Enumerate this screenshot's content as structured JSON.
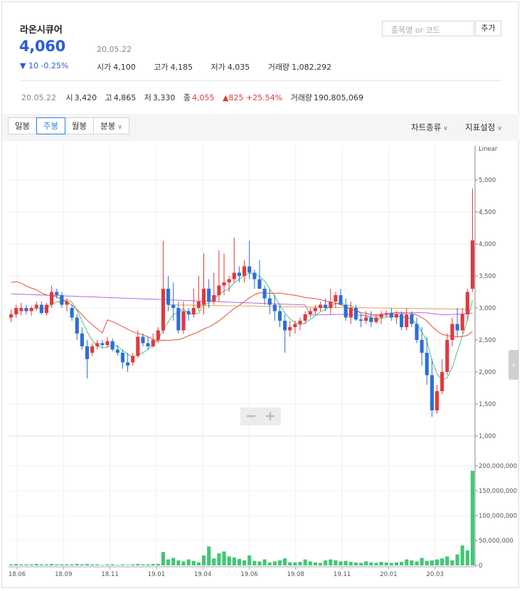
{
  "stock": {
    "name": "라온시큐어",
    "price": "4,060",
    "change": "▼ 10 -0.25%",
    "date": "20.05.22",
    "open_label": "시가",
    "open": "4,100",
    "high_label": "고가",
    "high": "4,185",
    "low_label": "저가",
    "low": "4,035",
    "volume_label": "거래량",
    "volume": "1,082,292"
  },
  "search": {
    "placeholder": "종목명 or 코드",
    "add_label": "추가"
  },
  "period_summary": {
    "date": "20.05.22",
    "open_label": "시",
    "open": "3,420",
    "high_label": "고",
    "high": "4,865",
    "low_label": "저",
    "low": "3,330",
    "close_label": "종",
    "close": "4,055",
    "change": "▲825 +25.54%",
    "volume_label": "거래량",
    "volume": "190,805,069"
  },
  "toolbar": {
    "tabs": [
      "일봉",
      "주봉",
      "월봉",
      "분봉"
    ],
    "active_tab": "주봉",
    "chart_type_label": "차트종류",
    "indicator_label": "지표설정"
  },
  "zoom": {
    "minus": "−",
    "plus": "+"
  },
  "colors": {
    "up": "#e0393e",
    "down": "#2b6fd6",
    "volume": "#41c774",
    "ma5": "#4ec37a",
    "ma20": "#e0533f",
    "ma60": "#b06ce0",
    "ma120": "#e5a35a"
  },
  "chart_data": {
    "type": "candlestick",
    "scale_label": "Linear",
    "price_axis": {
      "ticks": [
        "5,000",
        "4,500",
        "4,000",
        "3,500",
        "3,000",
        "2,500",
        "2,000",
        "1,500",
        "1,000"
      ],
      "ylim": [
        1000,
        5400
      ]
    },
    "volume_axis": {
      "ticks": [
        "200,000,000",
        "150,000,000",
        "100,000,000",
        "50,000,000",
        "0"
      ],
      "ylim": [
        0,
        220000000
      ]
    },
    "x_labels": [
      "18.06",
      "18.09",
      "18.11",
      "19.01",
      "19.04",
      "19.06",
      "19.08",
      "19.11",
      "20.01",
      "20.03"
    ],
    "candles": [
      {
        "o": 2850,
        "h": 2980,
        "l": 2780,
        "c": 2900
      },
      {
        "o": 2900,
        "h": 3050,
        "l": 2850,
        "c": 3000
      },
      {
        "o": 2950,
        "h": 3080,
        "l": 2880,
        "c": 3000
      },
      {
        "o": 3000,
        "h": 3050,
        "l": 2900,
        "c": 2950
      },
      {
        "o": 2950,
        "h": 3030,
        "l": 2880,
        "c": 3000
      },
      {
        "o": 3000,
        "h": 3100,
        "l": 2950,
        "c": 3050
      },
      {
        "o": 3050,
        "h": 3100,
        "l": 2900,
        "c": 2920
      },
      {
        "o": 2920,
        "h": 3080,
        "l": 2880,
        "c": 3050
      },
      {
        "o": 3050,
        "h": 3350,
        "l": 3000,
        "c": 3250
      },
      {
        "o": 3250,
        "h": 3300,
        "l": 3150,
        "c": 3200
      },
      {
        "o": 3200,
        "h": 3250,
        "l": 3000,
        "c": 3050
      },
      {
        "o": 3050,
        "h": 3150,
        "l": 2950,
        "c": 3100
      },
      {
        "o": 3000,
        "h": 3050,
        "l": 2800,
        "c": 2850
      },
      {
        "o": 2850,
        "h": 2900,
        "l": 2500,
        "c": 2600
      },
      {
        "o": 2600,
        "h": 2700,
        "l": 2350,
        "c": 2400
      },
      {
        "o": 2400,
        "h": 2500,
        "l": 1900,
        "c": 2200
      },
      {
        "o": 2300,
        "h": 2450,
        "l": 2250,
        "c": 2400
      },
      {
        "o": 2400,
        "h": 2500,
        "l": 2350,
        "c": 2450
      },
      {
        "o": 2450,
        "h": 2500,
        "l": 2380,
        "c": 2420
      },
      {
        "o": 2420,
        "h": 2550,
        "l": 2380,
        "c": 2480
      },
      {
        "o": 2480,
        "h": 2520,
        "l": 2320,
        "c": 2350
      },
      {
        "o": 2350,
        "h": 2420,
        "l": 2250,
        "c": 2300
      },
      {
        "o": 2300,
        "h": 2350,
        "l": 2050,
        "c": 2150
      },
      {
        "o": 2150,
        "h": 2300,
        "l": 2000,
        "c": 2100
      },
      {
        "o": 2150,
        "h": 2300,
        "l": 2100,
        "c": 2250
      },
      {
        "o": 2250,
        "h": 2650,
        "l": 2220,
        "c": 2550
      },
      {
        "o": 2550,
        "h": 2600,
        "l": 2400,
        "c": 2450
      },
      {
        "o": 2450,
        "h": 2550,
        "l": 2350,
        "c": 2400
      },
      {
        "o": 2400,
        "h": 2600,
        "l": 2380,
        "c": 2500
      },
      {
        "o": 2500,
        "h": 2700,
        "l": 2450,
        "c": 2650
      },
      {
        "o": 2650,
        "h": 4050,
        "l": 2600,
        "c": 3300
      },
      {
        "o": 3300,
        "h": 3500,
        "l": 2950,
        "c": 3050
      },
      {
        "o": 3050,
        "h": 3400,
        "l": 2800,
        "c": 3000
      },
      {
        "o": 3000,
        "h": 3100,
        "l": 2600,
        "c": 2650
      },
      {
        "o": 2650,
        "h": 3100,
        "l": 2600,
        "c": 2950
      },
      {
        "o": 2950,
        "h": 3000,
        "l": 2800,
        "c": 2900
      },
      {
        "o": 2900,
        "h": 3300,
        "l": 2850,
        "c": 3000
      },
      {
        "o": 3000,
        "h": 3500,
        "l": 2950,
        "c": 3100
      },
      {
        "o": 3050,
        "h": 3850,
        "l": 2900,
        "c": 3300
      },
      {
        "o": 3300,
        "h": 3450,
        "l": 3000,
        "c": 3100
      },
      {
        "o": 3100,
        "h": 3550,
        "l": 3050,
        "c": 3200
      },
      {
        "o": 3200,
        "h": 3900,
        "l": 3100,
        "c": 3350
      },
      {
        "o": 3350,
        "h": 3850,
        "l": 3200,
        "c": 3400
      },
      {
        "o": 3400,
        "h": 3500,
        "l": 3250,
        "c": 3450
      },
      {
        "o": 3450,
        "h": 4100,
        "l": 3400,
        "c": 3550
      },
      {
        "o": 3550,
        "h": 3650,
        "l": 3400,
        "c": 3500
      },
      {
        "o": 3500,
        "h": 3750,
        "l": 3400,
        "c": 3650
      },
      {
        "o": 3650,
        "h": 4050,
        "l": 3450,
        "c": 3550
      },
      {
        "o": 3550,
        "h": 3600,
        "l": 3300,
        "c": 3450
      },
      {
        "o": 3450,
        "h": 3750,
        "l": 3300,
        "c": 3300
      },
      {
        "o": 3300,
        "h": 3350,
        "l": 3050,
        "c": 3150
      },
      {
        "o": 3150,
        "h": 3300,
        "l": 2900,
        "c": 3050
      },
      {
        "o": 3050,
        "h": 3200,
        "l": 2800,
        "c": 2950
      },
      {
        "o": 2950,
        "h": 3050,
        "l": 2700,
        "c": 2800
      },
      {
        "o": 2800,
        "h": 2900,
        "l": 2300,
        "c": 2650
      },
      {
        "o": 2650,
        "h": 2800,
        "l": 2550,
        "c": 2700
      },
      {
        "o": 2700,
        "h": 2800,
        "l": 2600,
        "c": 2750
      },
      {
        "o": 2750,
        "h": 2850,
        "l": 2650,
        "c": 2800
      },
      {
        "o": 2800,
        "h": 2950,
        "l": 2750,
        "c": 2900
      },
      {
        "o": 2900,
        "h": 3000,
        "l": 2850,
        "c": 2950
      },
      {
        "o": 2950,
        "h": 3050,
        "l": 2900,
        "c": 3000
      },
      {
        "o": 3000,
        "h": 3100,
        "l": 2950,
        "c": 3050
      },
      {
        "o": 3050,
        "h": 3150,
        "l": 2950,
        "c": 3000
      },
      {
        "o": 3000,
        "h": 3300,
        "l": 2900,
        "c": 3100
      },
      {
        "o": 3100,
        "h": 3250,
        "l": 3000,
        "c": 3200
      },
      {
        "o": 3200,
        "h": 3300,
        "l": 3050,
        "c": 3050
      },
      {
        "o": 3050,
        "h": 3150,
        "l": 2800,
        "c": 2850
      },
      {
        "o": 2850,
        "h": 3100,
        "l": 2750,
        "c": 3000
      },
      {
        "o": 3000,
        "h": 3050,
        "l": 2800,
        "c": 2820
      },
      {
        "o": 2820,
        "h": 2900,
        "l": 2700,
        "c": 2800
      },
      {
        "o": 2800,
        "h": 2950,
        "l": 2750,
        "c": 2850
      },
      {
        "o": 2850,
        "h": 2950,
        "l": 2700,
        "c": 2780
      },
      {
        "o": 2780,
        "h": 2900,
        "l": 2750,
        "c": 2850
      },
      {
        "o": 2850,
        "h": 2950,
        "l": 2750,
        "c": 2900
      },
      {
        "o": 2900,
        "h": 2960,
        "l": 2850,
        "c": 2920
      },
      {
        "o": 2920,
        "h": 3000,
        "l": 2800,
        "c": 2850
      },
      {
        "o": 2850,
        "h": 2950,
        "l": 2750,
        "c": 2900
      },
      {
        "o": 2900,
        "h": 2950,
        "l": 2650,
        "c": 2700
      },
      {
        "o": 2700,
        "h": 3000,
        "l": 2650,
        "c": 2900
      },
      {
        "o": 2900,
        "h": 2950,
        "l": 2700,
        "c": 2750
      },
      {
        "o": 2750,
        "h": 2850,
        "l": 2450,
        "c": 2500
      },
      {
        "o": 2500,
        "h": 2700,
        "l": 2100,
        "c": 2300
      },
      {
        "o": 2300,
        "h": 2550,
        "l": 1800,
        "c": 1950
      },
      {
        "o": 1950,
        "h": 2200,
        "l": 1300,
        "c": 1400
      },
      {
        "o": 1400,
        "h": 1800,
        "l": 1350,
        "c": 1700
      },
      {
        "o": 1700,
        "h": 2200,
        "l": 1650,
        "c": 2000
      },
      {
        "o": 2000,
        "h": 2600,
        "l": 1950,
        "c": 2500
      },
      {
        "o": 2500,
        "h": 2850,
        "l": 2400,
        "c": 2750
      },
      {
        "o": 2750,
        "h": 3000,
        "l": 2550,
        "c": 2650
      },
      {
        "o": 2650,
        "h": 3000,
        "l": 2600,
        "c": 2900
      },
      {
        "o": 2900,
        "h": 3300,
        "l": 2800,
        "c": 3250
      },
      {
        "o": 3300,
        "h": 4865,
        "l": 3250,
        "c": 4055
      }
    ],
    "volumes": [
      2,
      3,
      2,
      2,
      2,
      3,
      2,
      2,
      3,
      2,
      2,
      2,
      2,
      3,
      2,
      3,
      2,
      2,
      1,
      2,
      2,
      1,
      2,
      1,
      2,
      3,
      2,
      2,
      3,
      3,
      27,
      12,
      15,
      10,
      8,
      12,
      9,
      6,
      20,
      38,
      14,
      24,
      28,
      18,
      16,
      13,
      10,
      20,
      9,
      8,
      12,
      6,
      8,
      10,
      14,
      6,
      6,
      7,
      12,
      8,
      6,
      5,
      10,
      12,
      10,
      8,
      9,
      7,
      6,
      5,
      8,
      6,
      5,
      7,
      6,
      5,
      6,
      7,
      12,
      10,
      8,
      15,
      9,
      10,
      12,
      14,
      18,
      10,
      22,
      40,
      30,
      190
    ]
  }
}
